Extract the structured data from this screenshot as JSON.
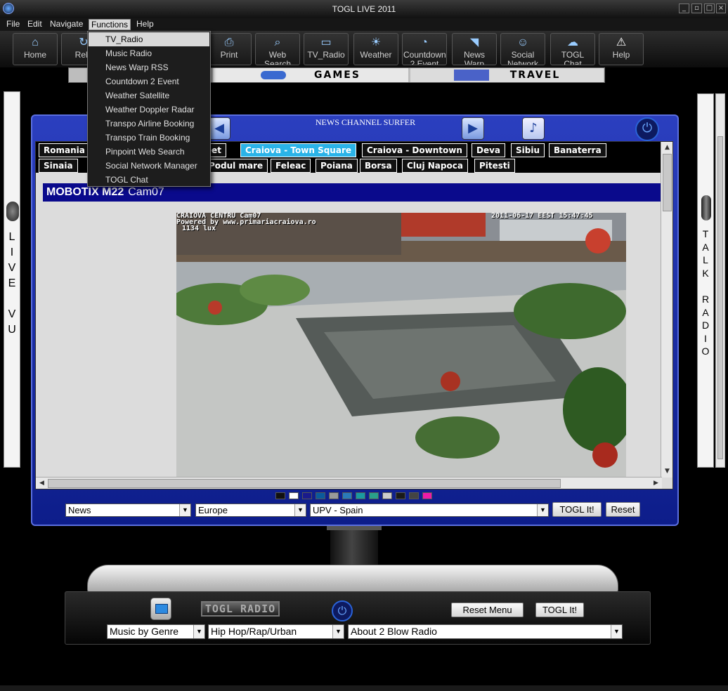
{
  "window": {
    "title": "TOGL LIVE 2011"
  },
  "menubar": [
    "File",
    "Edit",
    "Navigate",
    "Functions",
    "Help"
  ],
  "toolbar": [
    {
      "label": "Home",
      "icon": "home-icon"
    },
    {
      "label": "Relo",
      "icon": "reload-icon"
    },
    {
      "label": "",
      "icon": "blank"
    },
    {
      "label": "",
      "icon": "blank"
    },
    {
      "label": "Print",
      "icon": "print-icon"
    },
    {
      "label": "Web Search",
      "icon": "search-icon"
    },
    {
      "label": "TV_Radio",
      "icon": "tv-icon"
    },
    {
      "label": "Weather",
      "icon": "weather-icon"
    },
    {
      "label": "Countdown 2 Event",
      "icon": "countdown-icon"
    },
    {
      "label": "News Warp",
      "icon": "rss-icon"
    },
    {
      "label": "Social Network",
      "icon": "people-icon"
    },
    {
      "label": "TOGL Chat",
      "icon": "chat-icon"
    },
    {
      "label": "Help",
      "icon": "help-icon"
    }
  ],
  "functions_menu": [
    "TV_Radio",
    "Music Radio",
    "News Warp RSS",
    "Countdown 2 Event",
    "Weather Satellite",
    "Weather Doppler Radar",
    "Transpo Airline Booking",
    "Transpo Train Booking",
    "Pinpoint Web Search",
    "Social Network Manager",
    "TOGL Chat"
  ],
  "banner": {
    "games": "GAMES",
    "travel": "TRAVEL"
  },
  "left_panel": "L\nI\nV\nE\n\nV\nU",
  "right_panel": "T\nA\nL\nK\n\nR\nA\nD\nI\nO",
  "surfer": {
    "title": "NEWS CHANNEL SURFER",
    "tabs_row1": [
      "Romania -",
      "reet",
      "Craiova - Town Square",
      "Craiova - Downtown",
      "Deva",
      "Sibiu",
      "Banaterra"
    ],
    "tabs_row2": [
      "Sinaia",
      "Podul mare",
      "Feleac",
      "Poiana",
      "Borsa",
      "Cluj Napoca",
      "Pitesti"
    ],
    "selected_tab": "Craiova - Town Square",
    "cam_model": "MOBOTIX M22",
    "cam_name": "Cam07",
    "osd_line1": "CRAIOVA CENTRU Cam07",
    "osd_line2": "Powered by www.primariacraiova.ro",
    "osd_line3": "1134 lux",
    "osd_time": "2011-06-17 EEST 15:47:45",
    "filters": {
      "category": "News",
      "region": "Europe",
      "source": "UPV - Spain"
    },
    "togl_label": "TOGL It!",
    "reset_label": "Reset"
  },
  "swatches": [
    "#111111",
    "#ffffff",
    "#1a1a8c",
    "#0a5a9c",
    "#9a9a9a",
    "#2a7ab8",
    "#1a9aa0",
    "#2aa08a",
    "#cccccc",
    "#1a1a1a",
    "#444444",
    "#ee1aa8"
  ],
  "radio": {
    "logo": "TOGL RADIO",
    "reset_menu_label": "Reset Menu",
    "togl_label": "TOGL It!",
    "genre_mode": "Music by Genre",
    "genre": "Hip Hop/Rap/Urban",
    "station": "About 2 Blow Radio"
  }
}
